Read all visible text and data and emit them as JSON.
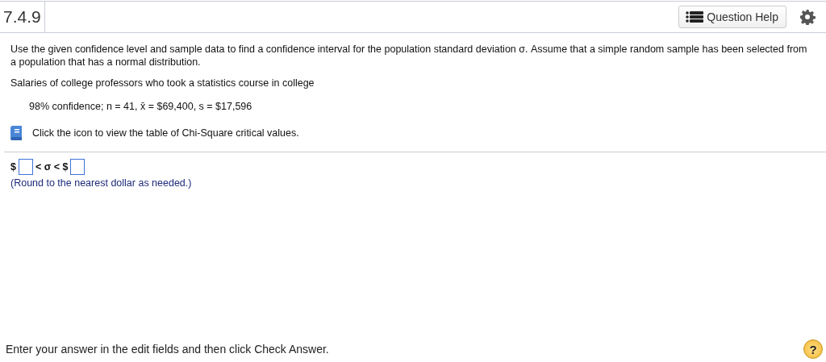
{
  "header": {
    "question_number": "7.4.9",
    "help_button": "Question Help"
  },
  "question": {
    "instructions": "Use the given confidence level and sample data to find a confidence interval for the population standard deviation σ. Assume that a simple random sample has been selected from a population that has a normal distribution.",
    "context": "Salaries of college professors who took a statistics course in college",
    "data": "98% confidence; n = 41, x̄ = $69,400, s = $17,596",
    "table_link": "Click the icon to view the table of Chi-Square critical values."
  },
  "answer": {
    "prefix": "$",
    "middle": "< σ < $",
    "note": "(Round to the nearest dollar as needed.)"
  },
  "footer": {
    "hint": "Enter your answer in the edit fields and then click Check Answer.",
    "help": "?"
  }
}
